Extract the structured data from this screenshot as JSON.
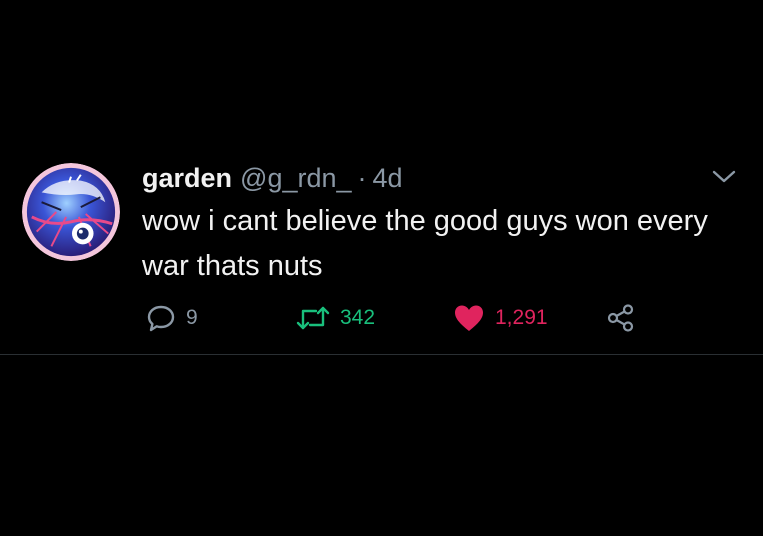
{
  "tweet": {
    "display_name": "garden",
    "handle": "@g_rdn_",
    "separator": "·",
    "time": "4d",
    "text": "wow i cant believe the good guys won every war thats nuts",
    "actions": {
      "replies": "9",
      "retweets": "342",
      "likes": "1,291"
    }
  },
  "icons": {
    "avatar": "pixel-art-eye-avatar",
    "caret": "chevron-down-icon",
    "reply": "reply-bubble-icon",
    "retweet": "retweet-icon",
    "like": "heart-icon",
    "share": "share-icon"
  },
  "colors": {
    "background": "#000000",
    "text": "#f2f2f2",
    "muted": "#8b98a5",
    "retweet": "#19bf7c",
    "like": "#e0245e"
  }
}
